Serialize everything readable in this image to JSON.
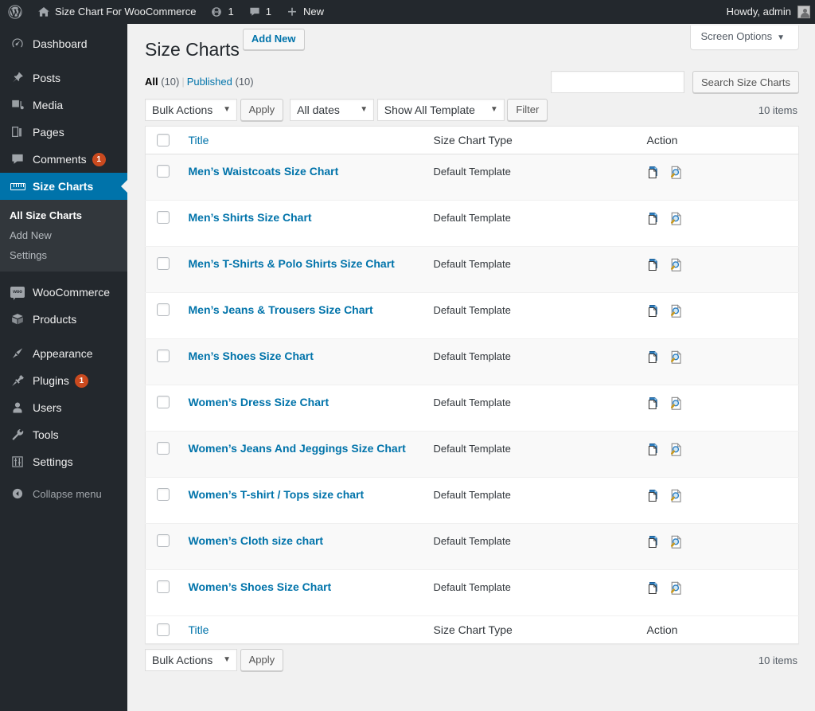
{
  "adminbar": {
    "logo_icon": "wordpress-logo-icon",
    "home_icon": "home-icon",
    "site_name": "Size Chart For WooCommerce",
    "updates_icon": "updates-icon",
    "updates_count": "1",
    "comments_icon": "comment-bubble-icon",
    "comments_count": "1",
    "new_icon": "plus-icon",
    "new_label": "New",
    "howdy": "Howdy, admin",
    "avatar": "user-avatar-icon"
  },
  "sidebar": {
    "items": [
      {
        "label": "Dashboard",
        "icon": "dashboard-icon",
        "key": "dashboard",
        "badge": ""
      },
      {
        "label": "Posts",
        "icon": "pin-icon",
        "key": "posts",
        "badge": ""
      },
      {
        "label": "Media",
        "icon": "media-icon",
        "key": "media",
        "badge": ""
      },
      {
        "label": "Pages",
        "icon": "pages-icon",
        "key": "pages",
        "badge": ""
      },
      {
        "label": "Comments",
        "icon": "comment-bubble-icon",
        "key": "comments",
        "badge": "1"
      },
      {
        "label": "Size Charts",
        "icon": "ruler-icon",
        "key": "size-charts",
        "badge": ""
      },
      {
        "label": "WooCommerce",
        "icon": "woocommerce-icon",
        "key": "woocommerce",
        "badge": ""
      },
      {
        "label": "Products",
        "icon": "products-box-icon",
        "key": "products",
        "badge": ""
      },
      {
        "label": "Appearance",
        "icon": "paintbrush-icon",
        "key": "appearance",
        "badge": ""
      },
      {
        "label": "Plugins",
        "icon": "plug-icon",
        "key": "plugins",
        "badge": "1"
      },
      {
        "label": "Users",
        "icon": "user-icon",
        "key": "users",
        "badge": ""
      },
      {
        "label": "Tools",
        "icon": "wrench-icon",
        "key": "tools",
        "badge": ""
      },
      {
        "label": "Settings",
        "icon": "sliders-icon",
        "key": "settings",
        "badge": ""
      }
    ],
    "submenu": [
      {
        "label": "All Size Charts",
        "current": true
      },
      {
        "label": "Add New",
        "current": false
      },
      {
        "label": "Settings",
        "current": false
      }
    ],
    "collapse_label": "Collapse menu",
    "collapse_icon": "collapse-arrow-icon",
    "active_key": "size-charts",
    "accent_color": "#0073aa",
    "background_color": "#23282d",
    "badge_color": "#ca4a1f"
  },
  "screen_meta": {
    "screen_options_label": "Screen Options",
    "caret_icon": "chevron-down-icon"
  },
  "header": {
    "title": "Size Charts",
    "add_new_label": "Add New"
  },
  "views": {
    "all_label": "All",
    "all_count": "(10)",
    "published_label": "Published",
    "published_count": "(10)",
    "divider": "|"
  },
  "search": {
    "value": "",
    "placeholder": "",
    "submit_label": "Search Size Charts"
  },
  "tablenav_top": {
    "bulk_actions_label": "Bulk Actions",
    "apply_label": "Apply",
    "dates_label": "All dates",
    "template_label": "Show All Template",
    "filter_label": "Filter",
    "displaying_num": "10 items",
    "select_arrow_icon": "chevron-down-icon"
  },
  "tablenav_bottom": {
    "bulk_actions_label": "Bulk Actions",
    "apply_label": "Apply",
    "displaying_num": "10 items",
    "select_arrow_icon": "chevron-down-icon"
  },
  "table": {
    "columns": {
      "cb": "select-all-checkbox",
      "title": "Title",
      "type": "Size Chart Type",
      "action": "Action"
    },
    "action_icons": {
      "duplicate": "duplicate-document-icon",
      "preview": "preview-document-icon"
    },
    "rows": [
      {
        "title": "Men’s Waistcoats Size Chart",
        "type": "Default Template"
      },
      {
        "title": "Men’s Shirts Size Chart",
        "type": "Default Template"
      },
      {
        "title": "Men’s T-Shirts & Polo Shirts Size Chart",
        "type": "Default Template"
      },
      {
        "title": "Men’s Jeans & Trousers Size Chart",
        "type": "Default Template"
      },
      {
        "title": "Men’s Shoes Size Chart",
        "type": "Default Template"
      },
      {
        "title": "Women’s Dress Size Chart",
        "type": "Default Template"
      },
      {
        "title": "Women’s Jeans And Jeggings Size Chart",
        "type": "Default Template"
      },
      {
        "title": "Women’s T-shirt / Tops size chart",
        "type": "Default Template"
      },
      {
        "title": "Women’s Cloth size chart",
        "type": "Default Template"
      },
      {
        "title": "Women’s Shoes Size Chart",
        "type": "Default Template"
      }
    ]
  }
}
